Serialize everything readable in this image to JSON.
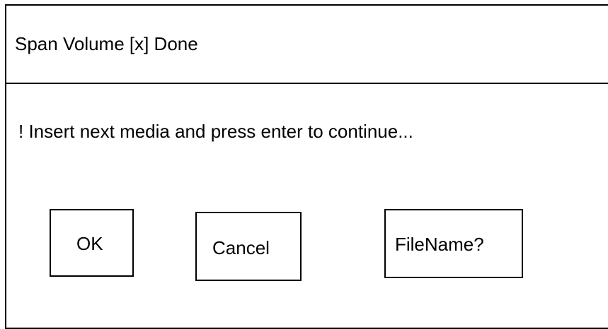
{
  "dialog": {
    "title": "Span Volume [x] Done",
    "message": "! Insert next media and press enter to continue..."
  },
  "buttons": {
    "ok_label": "OK",
    "cancel_label": "Cancel",
    "filename_label": "FileName?"
  }
}
